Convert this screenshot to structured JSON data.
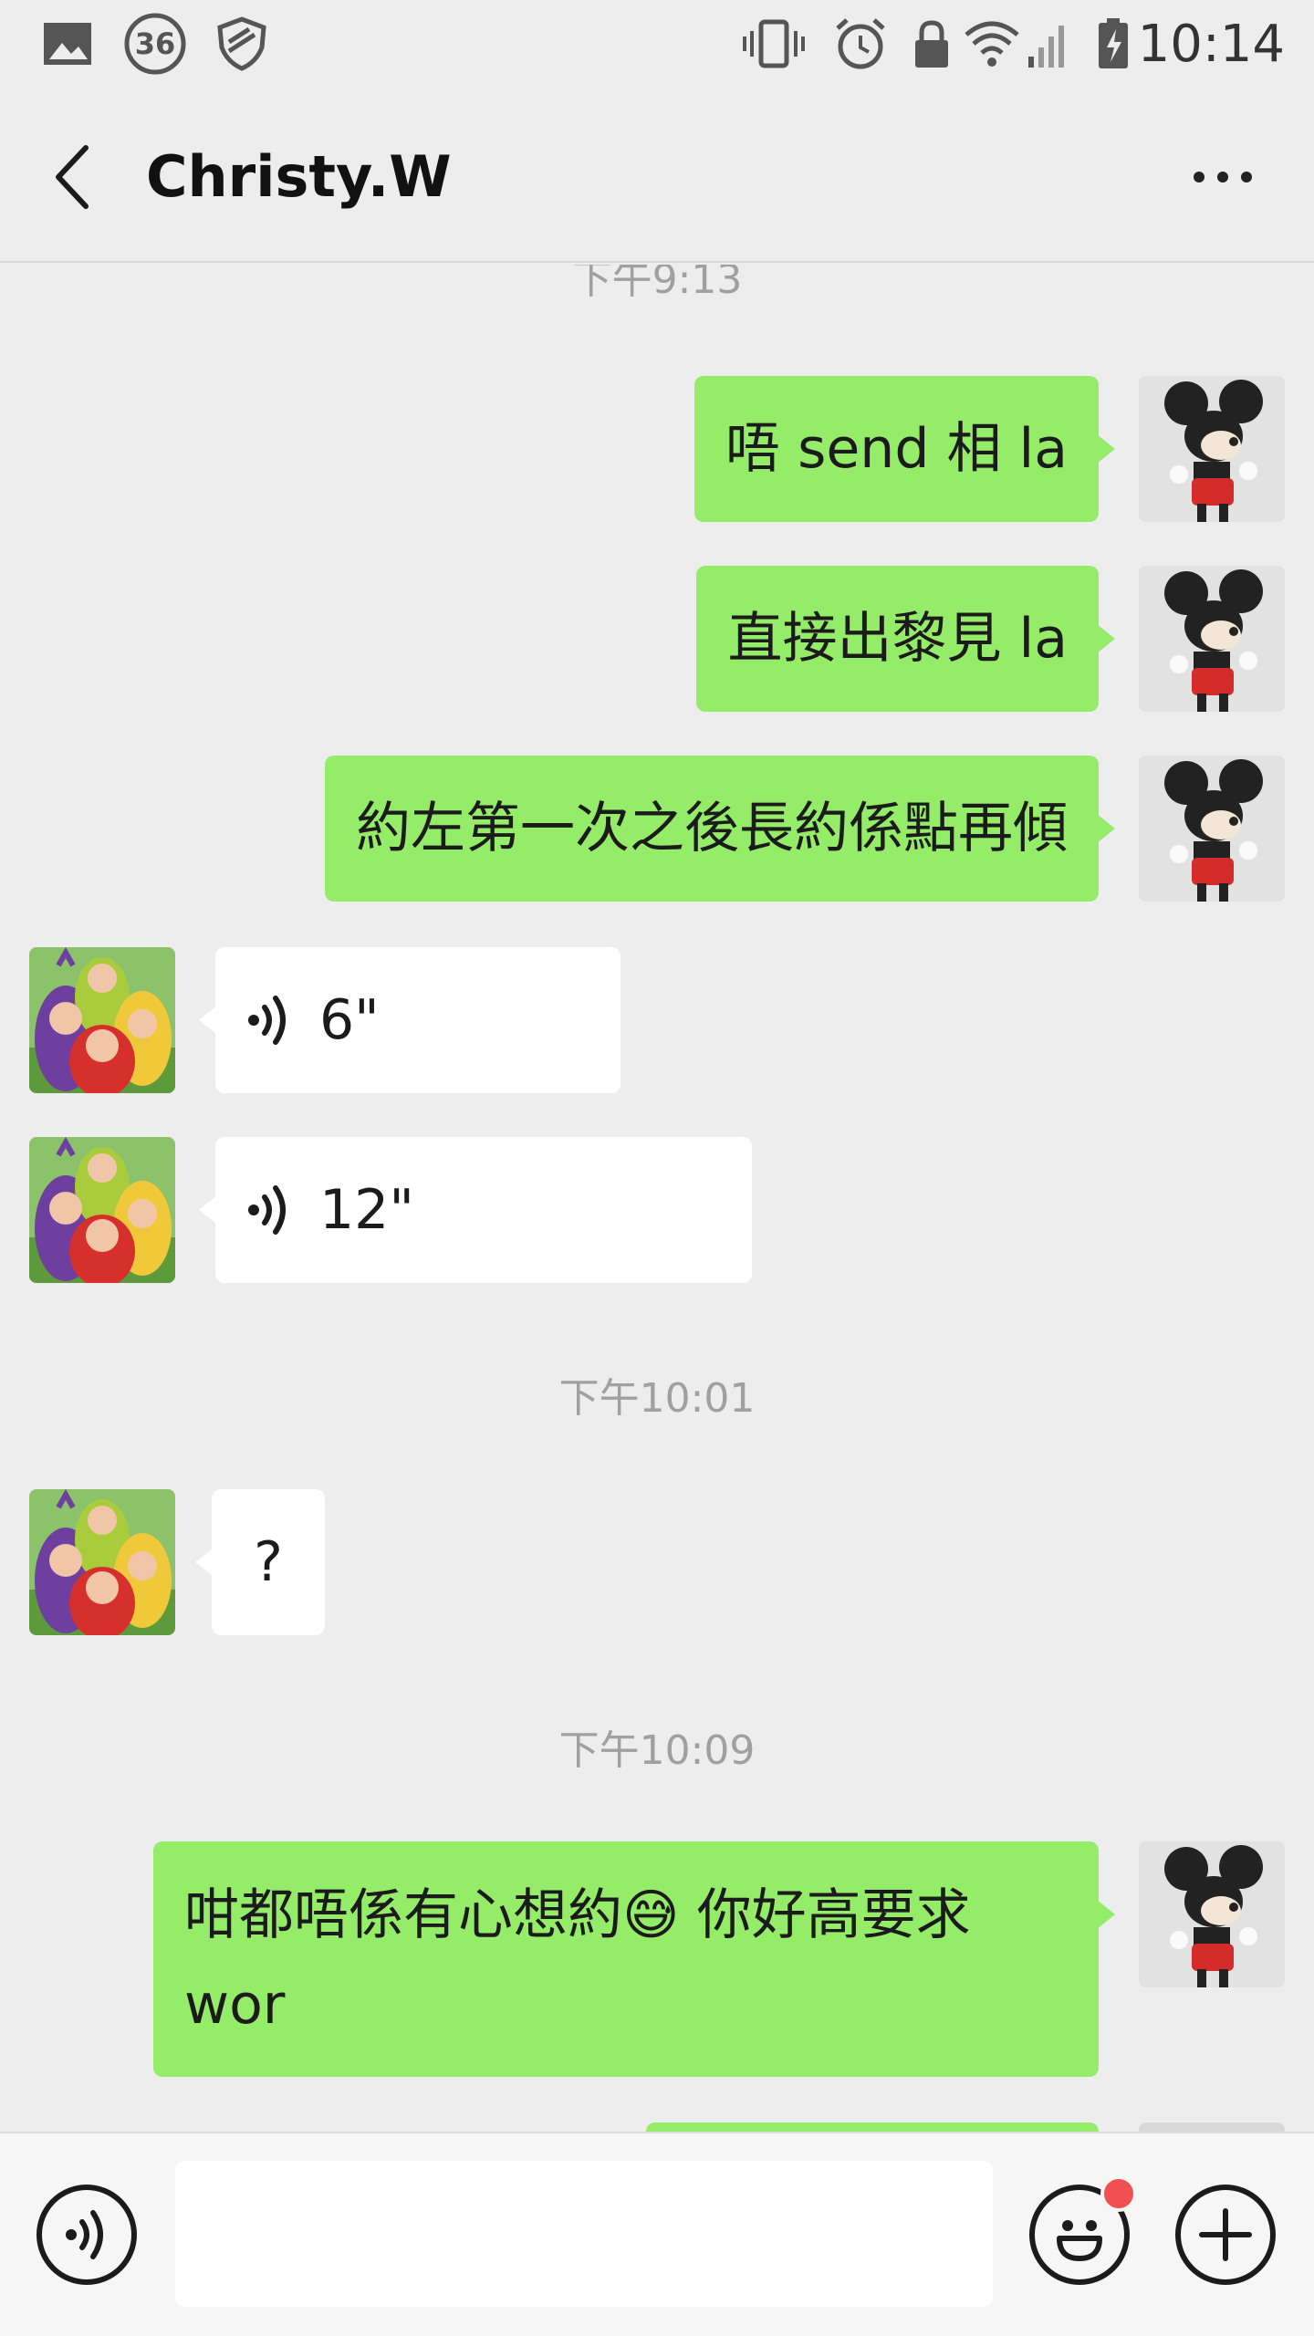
{
  "status_bar": {
    "time": "10:14",
    "notification_count": "36",
    "icons": [
      "image-icon",
      "badge-36-icon",
      "shield-icon",
      "vibrate-icon",
      "alarm-icon",
      "lock-icon",
      "wifi-icon",
      "signal-icon",
      "battery-charging-icon"
    ]
  },
  "header": {
    "title": "Christy.W",
    "back_icon": "chevron-left-icon",
    "more_icon": "more-dots-icon"
  },
  "chat": {
    "timestamps": [
      "下午9:13",
      "下午10:01",
      "下午10:09"
    ],
    "messages": [
      {
        "from": "me",
        "type": "text",
        "text": "唔 send 相 la"
      },
      {
        "from": "me",
        "type": "text",
        "text": "直接出黎見 la"
      },
      {
        "from": "me",
        "type": "text",
        "text": "約左第一次之後長約係點再傾"
      },
      {
        "from": "other",
        "type": "voice",
        "duration": "6\""
      },
      {
        "from": "other",
        "type": "voice",
        "duration": "12\""
      },
      {
        "from": "other",
        "type": "text",
        "text": "?"
      },
      {
        "from": "me",
        "type": "text",
        "text": "咁都唔係有心想約😅 你好高要求\nwor"
      }
    ]
  },
  "input_bar": {
    "voice_icon": "voice-mode-icon",
    "input_value": "",
    "emoji_icon": "emoji-icon",
    "plus_icon": "plus-icon"
  },
  "colors": {
    "background": "#ededed",
    "my_bubble": "#95ec69",
    "their_bubble": "#ffffff",
    "badge": "#f05050"
  }
}
